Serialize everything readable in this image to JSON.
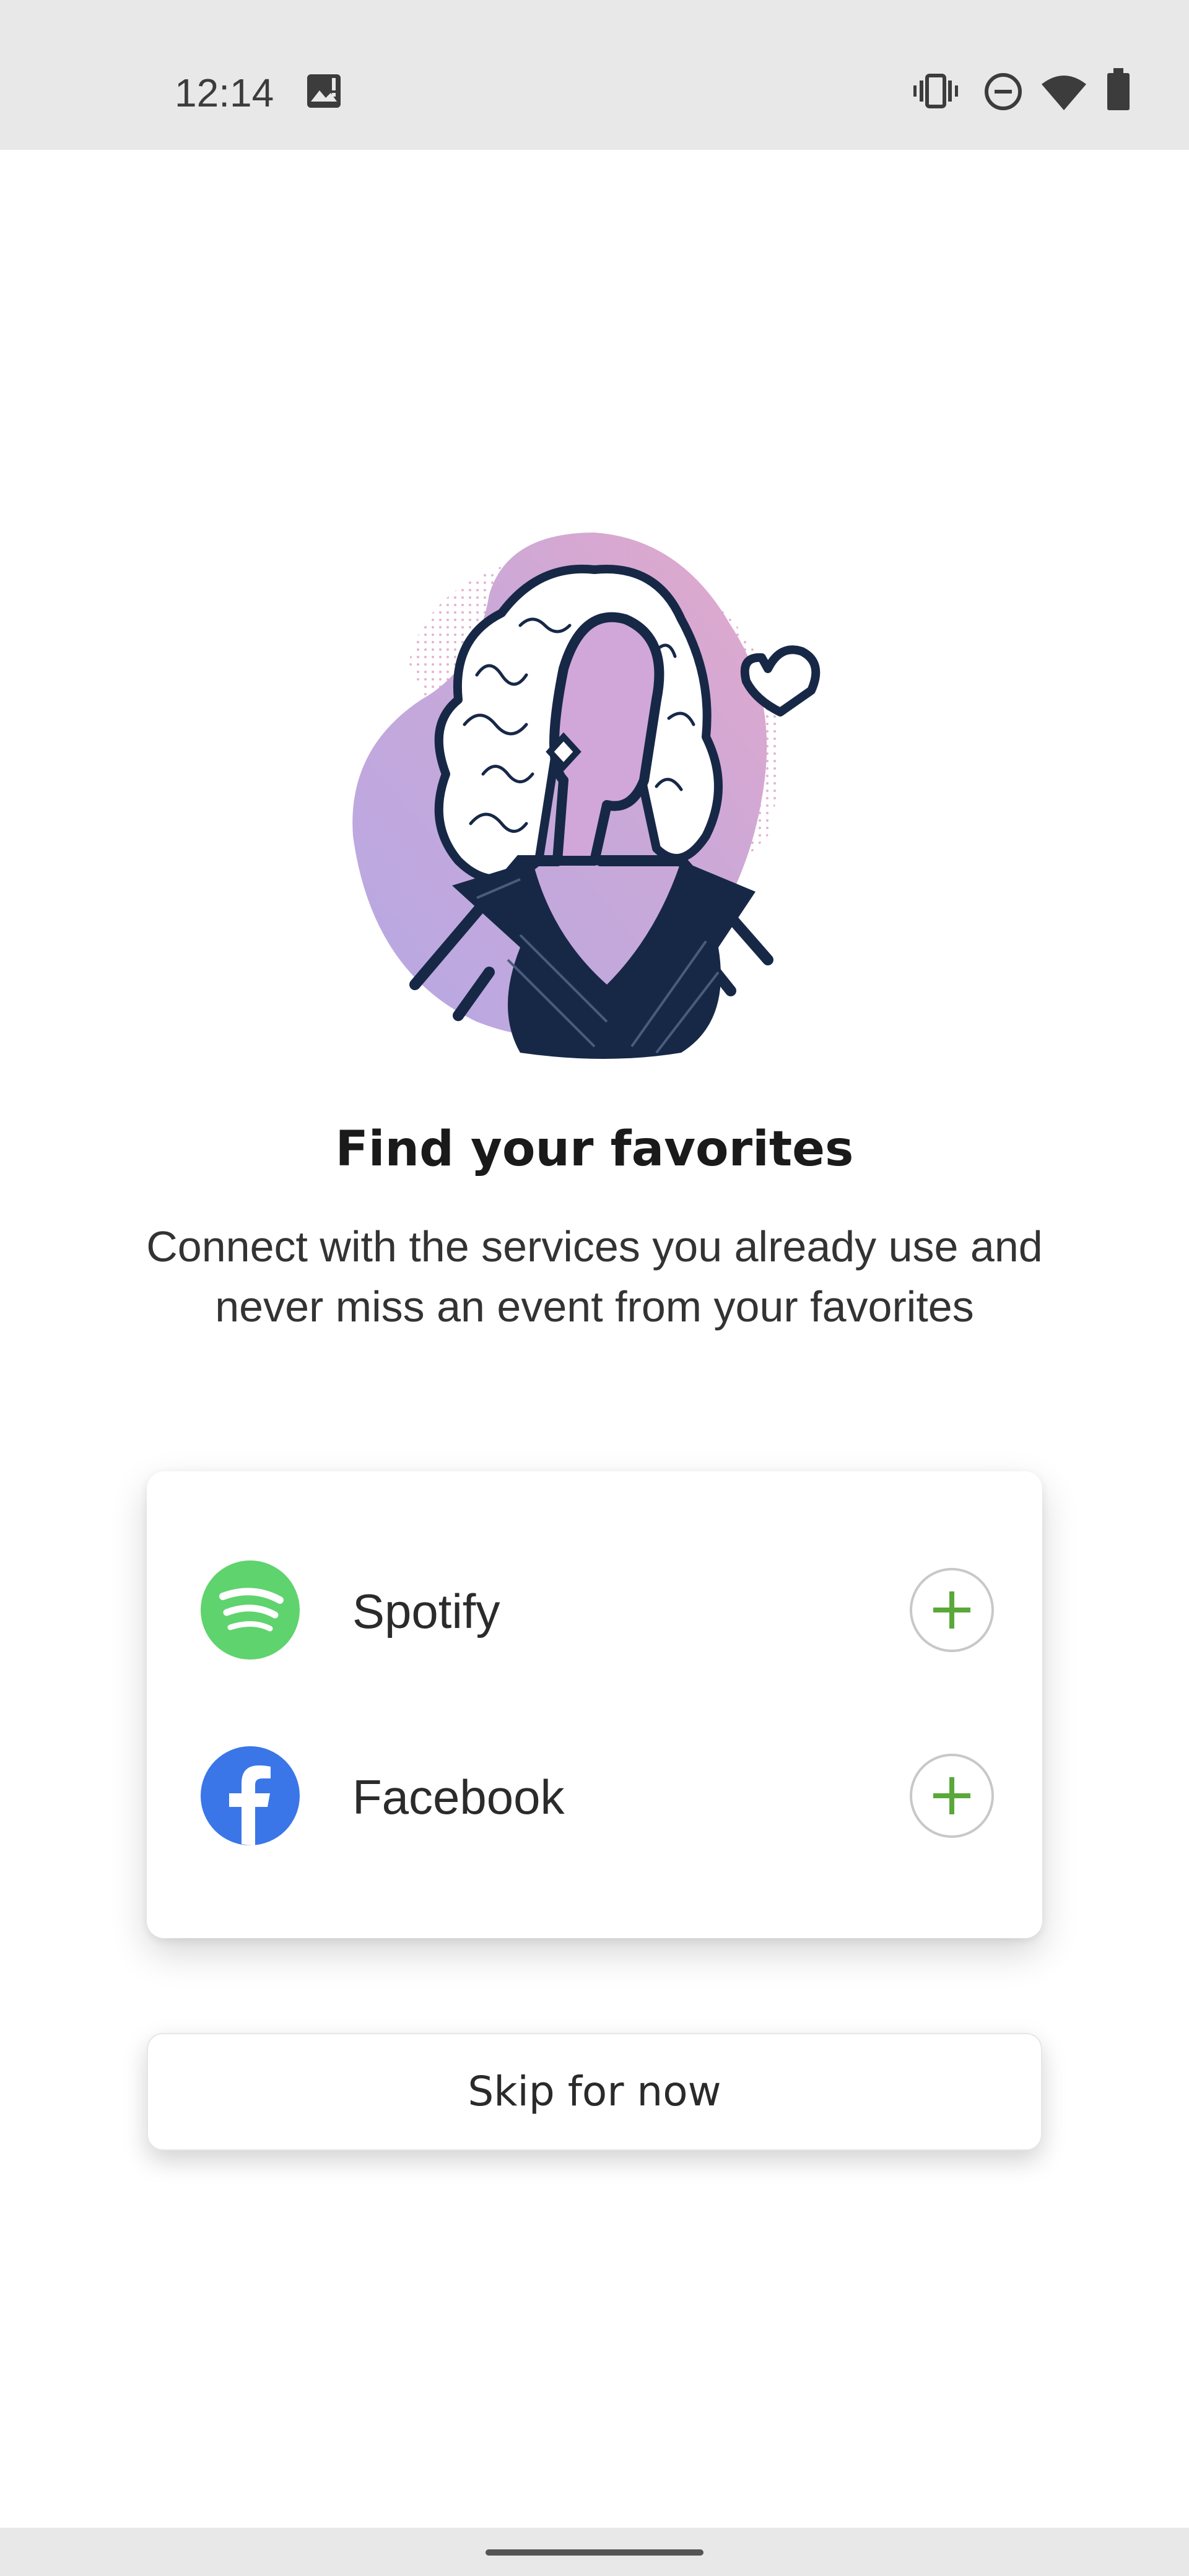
{
  "status_bar": {
    "time": "12:14",
    "icons": [
      "image-notification-icon",
      "vibrate-icon",
      "do-not-disturb-icon",
      "wifi-icon",
      "battery-icon"
    ]
  },
  "onboarding": {
    "title": "Find your favorites",
    "subtitle": "Connect with the services you already use and never miss an event from your favorites"
  },
  "services": [
    {
      "label": "Spotify",
      "icon": "spotify-logo-icon",
      "color": "#5fd36e",
      "action_icon": "plus-icon"
    },
    {
      "label": "Facebook",
      "icon": "facebook-logo-icon",
      "color": "#3b76e8",
      "action_icon": "plus-icon"
    }
  ],
  "skip_label": "Skip for now",
  "colors": {
    "accent_green": "#5aa83a",
    "illustration_navy": "#172847",
    "illustration_pink": "#e0a9cf",
    "illustration_lavender": "#b9a6e0"
  }
}
